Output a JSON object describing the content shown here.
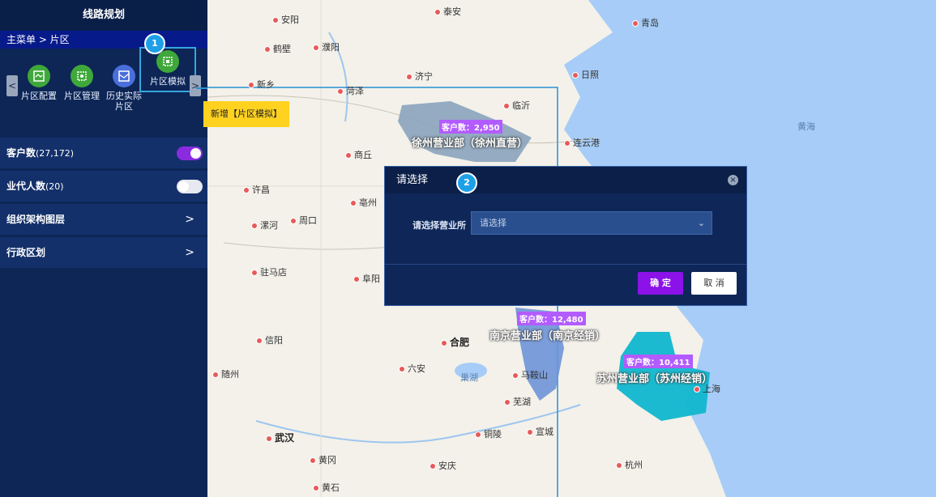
{
  "sidebar": {
    "title": "线路规划",
    "breadcrumb": "主菜单 > 片区",
    "nav_prev": "<",
    "nav_next": ">",
    "icons": [
      {
        "label": "片区配置",
        "icon": "map-config-icon"
      },
      {
        "label": "片区管理",
        "icon": "area-manage-icon"
      },
      {
        "label": "历史实际片区",
        "icon": "history-map-icon"
      },
      {
        "label": "片区模拟",
        "icon": "area-simulate-icon"
      }
    ],
    "rows": [
      {
        "label": "客户数",
        "count": "(27,172)",
        "toggle": "on"
      },
      {
        "label": "业代人数",
        "count": "(20)",
        "toggle": "off"
      },
      {
        "label": "组织架构图层",
        "chevron": ">"
      },
      {
        "label": "行政区划",
        "chevron": ">"
      }
    ]
  },
  "tooltip": "新增【片区模拟】",
  "badges": [
    "1",
    "2"
  ],
  "map": {
    "cities": [
      {
        "name": "安阳"
      },
      {
        "name": "泰安"
      },
      {
        "name": "青岛"
      },
      {
        "name": "鹤壁"
      },
      {
        "name": "濮阳"
      },
      {
        "name": "济宁"
      },
      {
        "name": "日照"
      },
      {
        "name": "新乡"
      },
      {
        "name": "菏泽"
      },
      {
        "name": "临沂"
      },
      {
        "name": "连云港"
      },
      {
        "name": "商丘"
      },
      {
        "name": "许昌"
      },
      {
        "name": "亳州"
      },
      {
        "name": "漯河"
      },
      {
        "name": "周口"
      },
      {
        "name": "驻马店"
      },
      {
        "name": "阜阳"
      },
      {
        "name": "信阳"
      },
      {
        "name": "合肥"
      },
      {
        "name": "六安"
      },
      {
        "name": "马鞍山"
      },
      {
        "name": "芜湖"
      },
      {
        "name": "随州"
      },
      {
        "name": "铜陵"
      },
      {
        "name": "宣城"
      },
      {
        "name": "上海"
      },
      {
        "name": "武汉"
      },
      {
        "name": "黄冈"
      },
      {
        "name": "安庆"
      },
      {
        "name": "杭州"
      },
      {
        "name": "黄石"
      }
    ],
    "sea": "黄海",
    "lake": "巢湖",
    "regions": [
      {
        "name": "徐州营业部（徐州直营）",
        "count": "客户数：2,950"
      },
      {
        "name": "南京营业部（南京经销）",
        "count": "客户数：12,480"
      },
      {
        "name": "苏州营业部（苏州经销）",
        "count": "客户数：10,411"
      }
    ]
  },
  "dialog": {
    "title": "请选择",
    "close": "×",
    "field_label": "请选择营业所",
    "field_placeholder": "请选择",
    "ok": "确 定",
    "cancel": "取 消"
  }
}
